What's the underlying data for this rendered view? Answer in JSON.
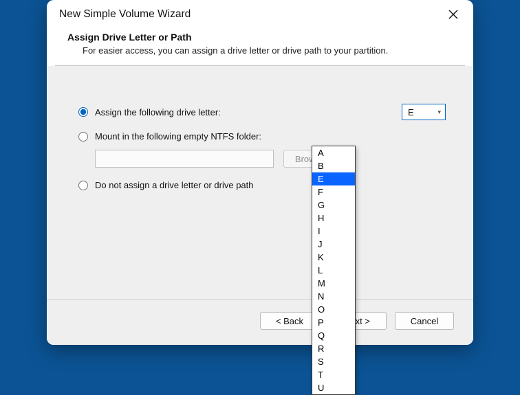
{
  "window": {
    "title": "New Simple Volume Wizard"
  },
  "header": {
    "heading": "Assign Drive Letter or Path",
    "sub": "For easier access, you can assign a drive letter or drive path to your partition."
  },
  "options": {
    "assign_label": "Assign the following drive letter:",
    "mount_label": "Mount in the following empty NTFS folder:",
    "none_label": "Do not assign a drive letter or drive path",
    "browse_label": "Browse...",
    "path_value": ""
  },
  "drive": {
    "selected": "E",
    "list": [
      "A",
      "B",
      "E",
      "F",
      "G",
      "H",
      "I",
      "J",
      "K",
      "L",
      "M",
      "N",
      "O",
      "P",
      "Q",
      "R",
      "S",
      "T",
      "U"
    ]
  },
  "buttons": {
    "back": "< Back",
    "next": "Next >",
    "cancel": "Cancel"
  }
}
